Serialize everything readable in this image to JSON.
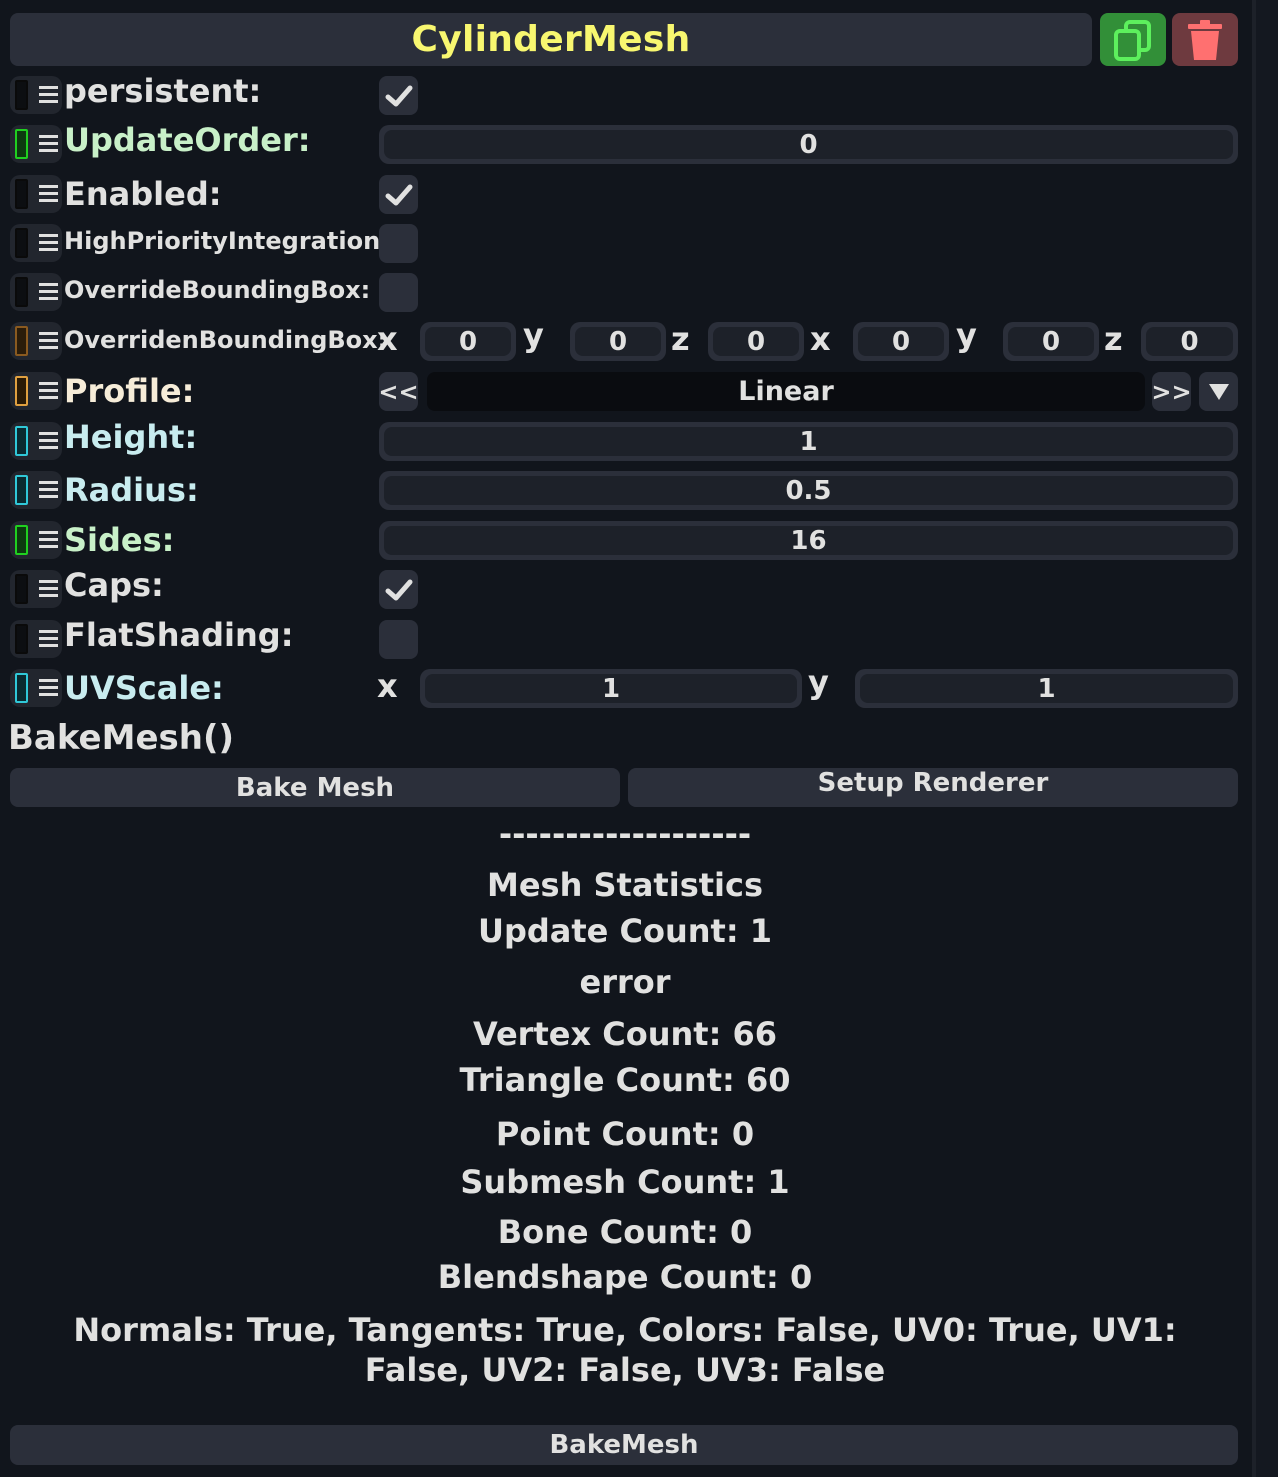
{
  "component": {
    "title": "CylinderMesh",
    "duplicate_icon": "duplicate-icon",
    "delete_icon": "trash-icon",
    "accent": "#f8f770"
  },
  "fields": {
    "persistent": {
      "label": "persistent:",
      "checked": true
    },
    "update_order": {
      "label": "UpdateOrder:",
      "value": "0"
    },
    "enabled": {
      "label": "Enabled:",
      "checked": true
    },
    "high_priority": {
      "label": "HighPriorityIntegration:",
      "checked": false
    },
    "override_bbox": {
      "label": "OverrideBoundingBox:",
      "checked": false
    },
    "overriden_bbox": {
      "label": "OverridenBoundingBox:",
      "axes": [
        "x",
        "y",
        "z",
        "x",
        "y",
        "z"
      ],
      "values": [
        "0",
        "0",
        "0",
        "0",
        "0",
        "0"
      ]
    },
    "profile": {
      "label": "Profile:",
      "value": "Linear",
      "prev": "<<",
      "next": ">>"
    },
    "height": {
      "label": "Height:",
      "value": "1"
    },
    "radius": {
      "label": "Radius:",
      "value": "0.5"
    },
    "sides": {
      "label": "Sides:",
      "value": "16"
    },
    "caps": {
      "label": "Caps:",
      "checked": true
    },
    "flat_shading": {
      "label": "FlatShading:",
      "checked": false
    },
    "uv_scale": {
      "label": "UVScale:",
      "x_label": "x",
      "x": "1",
      "y_label": "y",
      "y": "1"
    }
  },
  "bake": {
    "method_label": "BakeMesh()",
    "bake_mesh_button": "Bake Mesh",
    "setup_renderer_button": "Setup Renderer"
  },
  "stats": {
    "separator": "-------------------",
    "title": "Mesh Statistics",
    "update_count": "Update Count: 1",
    "error": "error",
    "vertex_count": "Vertex Count: 66",
    "triangle_count": "Triangle Count: 60",
    "point_count": "Point Count: 0",
    "submesh_count": "Submesh Count: 1",
    "bone_count": "Bone Count: 0",
    "blendshape_count": "Blendshape Count: 0",
    "attributes": "Normals: True, Tangents: True, Colors: False, UV0: True, UV1: False, UV2: False, UV3: False"
  },
  "footer": {
    "bake_mesh_button": "BakeMesh"
  },
  "colors": {
    "bool": "#e1e1e0",
    "int": "#c8f0c8",
    "float": "#c8ecef",
    "enum": "#f6ecd8",
    "duplicate_bg": "#328f38",
    "delete_bg": "#6e3a3f"
  }
}
